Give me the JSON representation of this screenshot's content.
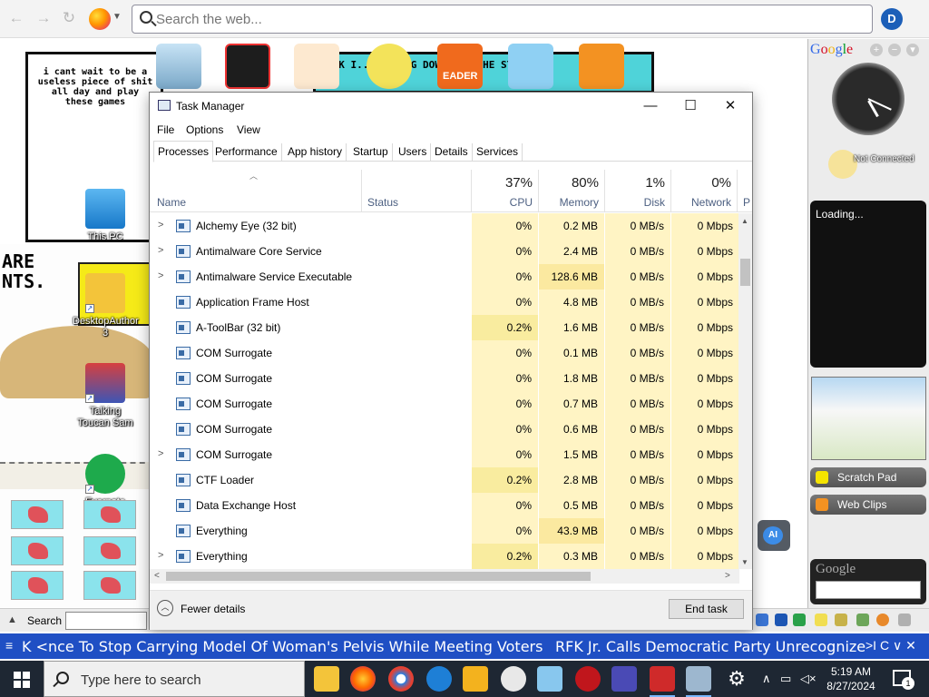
{
  "browser": {
    "search_placeholder": "Search the web...",
    "ext_letter": "D"
  },
  "comics": {
    "panel_a_text": "i cant wait to be a useless piece of shit all day and play these games",
    "panel_b_text": "ACK I... ALLING DOWN ... THE STAIRS",
    "panel_c_text": "ARE\nNTS.",
    "reader_label": "EADER"
  },
  "desktop_icons": [
    {
      "label": "This PC"
    },
    {
      "label": "DesktopAuthor 3"
    },
    {
      "label": "Talking Toucan Sam"
    },
    {
      "label": "Evernote"
    }
  ],
  "task_manager": {
    "title": "Task Manager",
    "menu": [
      "File",
      "Options",
      "View"
    ],
    "tabs": [
      "Processes",
      "Performance",
      "App history",
      "Startup",
      "Users",
      "Details",
      "Services"
    ],
    "active_tab": "Processes",
    "columns": {
      "name": "Name",
      "status": "Status",
      "cpu": {
        "label": "CPU",
        "pct": "37%"
      },
      "memory": {
        "label": "Memory",
        "pct": "80%"
      },
      "disk": {
        "label": "Disk",
        "pct": "1%"
      },
      "network": {
        "label": "Network",
        "pct": "0%"
      },
      "power_partial": "P"
    },
    "processes": [
      {
        "name": "Alchemy Eye (32 bit)",
        "expandable": true,
        "cpu": "0%",
        "mem": "0.2 MB",
        "disk": "0 MB/s",
        "net": "0 Mbps"
      },
      {
        "name": "Antimalware Core Service",
        "expandable": true,
        "cpu": "0%",
        "mem": "2.4 MB",
        "disk": "0 MB/s",
        "net": "0 Mbps"
      },
      {
        "name": "Antimalware Service Executable",
        "expandable": true,
        "cpu": "0%",
        "mem": "128.6 MB",
        "disk": "0 MB/s",
        "net": "0 Mbps"
      },
      {
        "name": "Application Frame Host",
        "expandable": false,
        "cpu": "0%",
        "mem": "4.8 MB",
        "disk": "0 MB/s",
        "net": "0 Mbps"
      },
      {
        "name": "A-ToolBar (32 bit)",
        "expandable": false,
        "cpu": "0.2%",
        "mem": "1.6 MB",
        "disk": "0 MB/s",
        "net": "0 Mbps"
      },
      {
        "name": "COM Surrogate",
        "expandable": false,
        "cpu": "0%",
        "mem": "0.1 MB",
        "disk": "0 MB/s",
        "net": "0 Mbps"
      },
      {
        "name": "COM Surrogate",
        "expandable": false,
        "cpu": "0%",
        "mem": "1.8 MB",
        "disk": "0 MB/s",
        "net": "0 Mbps"
      },
      {
        "name": "COM Surrogate",
        "expandable": false,
        "cpu": "0%",
        "mem": "0.7 MB",
        "disk": "0 MB/s",
        "net": "0 Mbps"
      },
      {
        "name": "COM Surrogate",
        "expandable": false,
        "cpu": "0%",
        "mem": "0.6 MB",
        "disk": "0 MB/s",
        "net": "0 Mbps"
      },
      {
        "name": "COM Surrogate",
        "expandable": true,
        "cpu": "0%",
        "mem": "1.5 MB",
        "disk": "0 MB/s",
        "net": "0 Mbps"
      },
      {
        "name": "CTF Loader",
        "expandable": false,
        "cpu": "0.2%",
        "mem": "2.8 MB",
        "disk": "0 MB/s",
        "net": "0 Mbps"
      },
      {
        "name": "Data Exchange Host",
        "expandable": false,
        "cpu": "0%",
        "mem": "0.5 MB",
        "disk": "0 MB/s",
        "net": "0 Mbps"
      },
      {
        "name": "Everything",
        "expandable": false,
        "cpu": "0%",
        "mem": "43.9 MB",
        "disk": "0 MB/s",
        "net": "0 Mbps"
      },
      {
        "name": "Everything",
        "expandable": true,
        "cpu": "0.2%",
        "mem": "0.3 MB",
        "disk": "0 MB/s",
        "net": "0 Mbps"
      }
    ],
    "fewer_details": "Fewer details",
    "end_task": "End task"
  },
  "gadgets": {
    "google_label": "Google",
    "status": "Not Connected",
    "loading": "Loading...",
    "scratch_pad": "Scratch Pad",
    "web_clips": "Web Clips",
    "search_label": "Google"
  },
  "ai_badge": "AI",
  "desk_toolbar": {
    "search_label": "Search :"
  },
  "ticker": {
    "headline_1": "K <nce To Stop Carrying Model Of Woman's Pelvis While Meeting Voters",
    "headline_2": "RFK Jr. Calls Democratic Party Unrecognize",
    "controls": ">I C ∨ ✕"
  },
  "taskbar": {
    "search_placeholder": "Type here to search",
    "time": "5:19 AM",
    "date": "8/27/2024",
    "notif_count": "1"
  },
  "colors": {
    "ticker_bg": "#1f4fc4",
    "taskbar_bg": "#1e2733",
    "heat_cell": "#fff4c4",
    "accent": "#0a64d8"
  }
}
